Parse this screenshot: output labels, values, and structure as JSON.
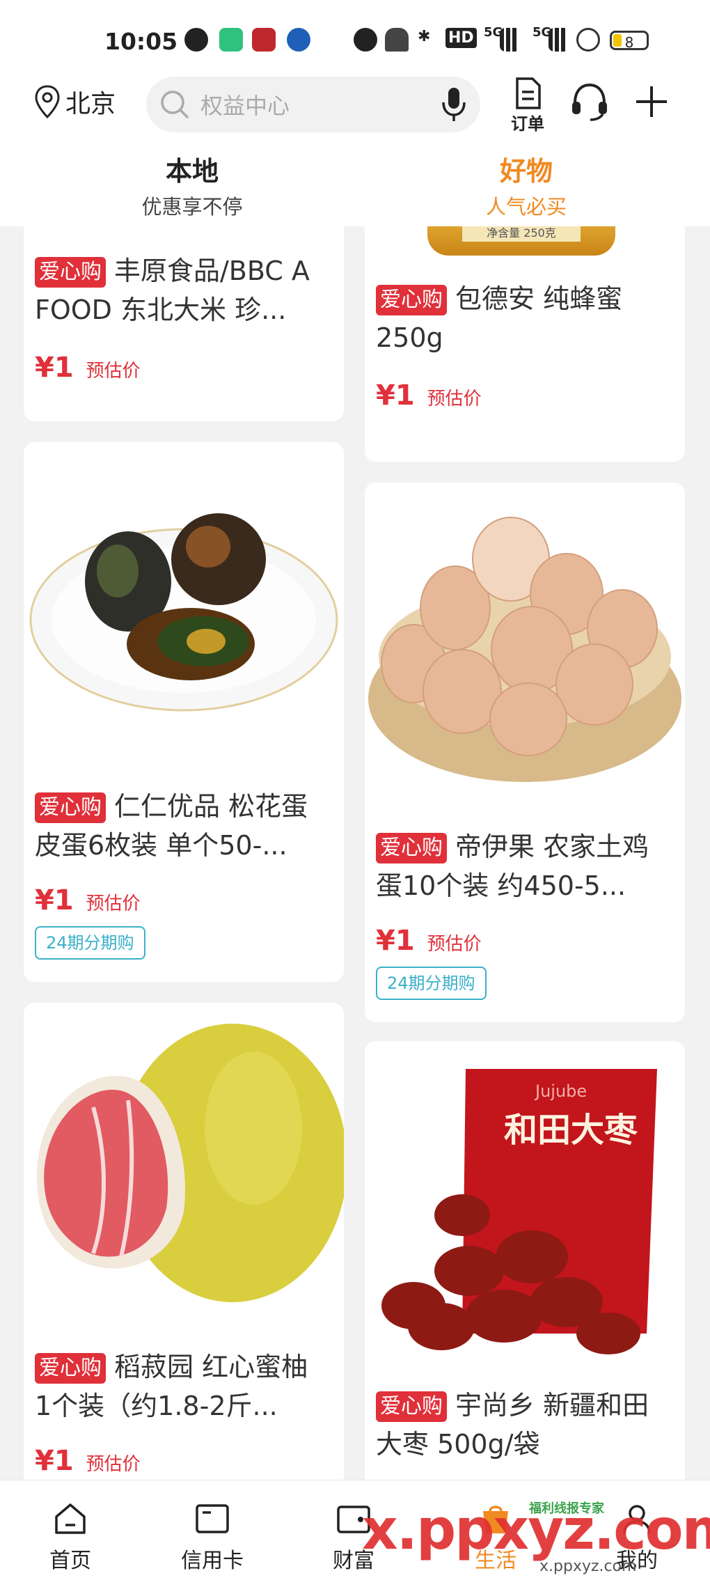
{
  "status_bar": {
    "time": "10:05",
    "hd": "HD",
    "net1": "5G",
    "net2": "5G",
    "battery": "8"
  },
  "header": {
    "location": "北京",
    "search_placeholder": "权益中心",
    "orders_label": "订单"
  },
  "tabs": [
    {
      "title": "本地",
      "subtitle": "优惠享不停"
    },
    {
      "title": "好物",
      "subtitle": "人气必买"
    }
  ],
  "feed": {
    "tag": "爱心购",
    "currency_price": "¥1",
    "estimate_label": "预估价",
    "installment_label": "24期分期购",
    "products": [
      {
        "title": "丰原食品/BBC A FOOD 东北大米 珍..."
      },
      {
        "title": "包德安 纯蜂蜜 250g",
        "jar_text": "净含量 250克"
      },
      {
        "title": "仁仁优品 松花蛋皮蛋6枚装 单个50-..."
      },
      {
        "title": "帝伊果 农家土鸡蛋10个装 约450-5..."
      },
      {
        "title": "稻菽园 红心蜜柚 1个装（约1.8-2斤..."
      },
      {
        "title": "宇尚乡 新疆和田大枣 500g/袋",
        "package_text": "和田大枣",
        "package_sub": "Jujube"
      }
    ]
  },
  "bottom_nav": [
    {
      "label": "首页"
    },
    {
      "label": "信用卡"
    },
    {
      "label": "财富"
    },
    {
      "label": "生活"
    },
    {
      "label": "我的"
    }
  ],
  "watermark": {
    "main": "x.ppxyz.com",
    "small": "福利线报专家",
    "url": "x.ppxyz.com"
  },
  "colors": {
    "accent_orange": "#f08a22",
    "tag_red": "#e0303a",
    "installment_blue": "#3bb0c9"
  }
}
